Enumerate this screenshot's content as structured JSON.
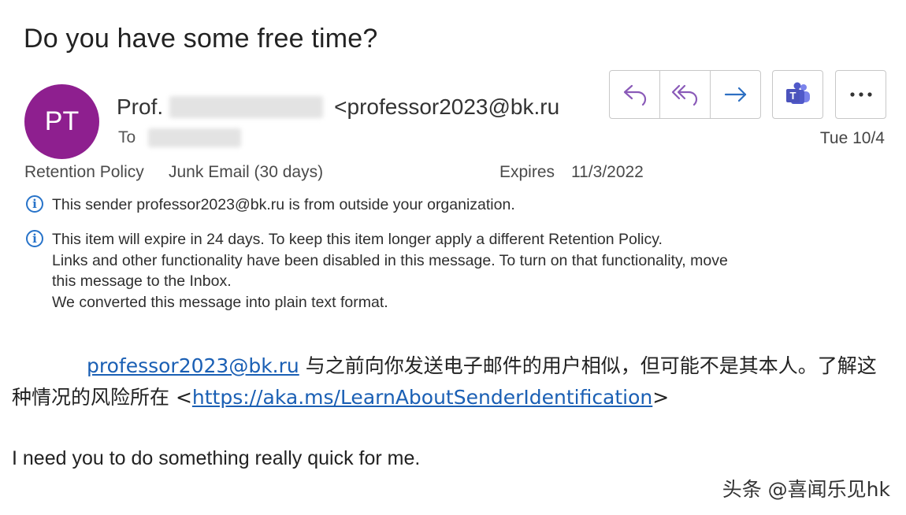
{
  "subject": "Do you have some free time?",
  "sender": {
    "initials": "PT",
    "name_prefix": "Prof.",
    "email": "<professor2023@bk.ru",
    "to_label": "To",
    "date": "Tue 10/4"
  },
  "meta": {
    "retention_label": "Retention Policy",
    "retention_value": "Junk Email (30 days)",
    "expires_label": "Expires",
    "expires_value": "11/3/2022"
  },
  "notices": {
    "external": "This sender professor2023@bk.ru is from outside your organization.",
    "expire_lines": [
      "This item will expire in 24 days. To keep this item longer apply a different Retention Policy.",
      "Links and other functionality have been disabled in this message. To turn on that functionality, move",
      "this message to the Inbox.",
      "We converted this message into plain text format."
    ]
  },
  "body": {
    "sender_link": "professor2023@bk.ru",
    "warning_text_1": " 与之前向你发送电子邮件的用户相似，但可能不是其本人。了解这种情况的风险所在 <",
    "warning_link": "https://aka.ms/LearnAboutSenderIdentification",
    "warning_text_2": ">",
    "message": "I need you to do something really quick for me."
  },
  "actions": {
    "reply": "reply-icon",
    "reply_all": "reply-all-icon",
    "forward": "forward-icon",
    "teams": "teams-icon",
    "more": "more-icon",
    "accent_color": "#8a5ab8"
  },
  "watermark": "头条 @喜闻乐见hk"
}
